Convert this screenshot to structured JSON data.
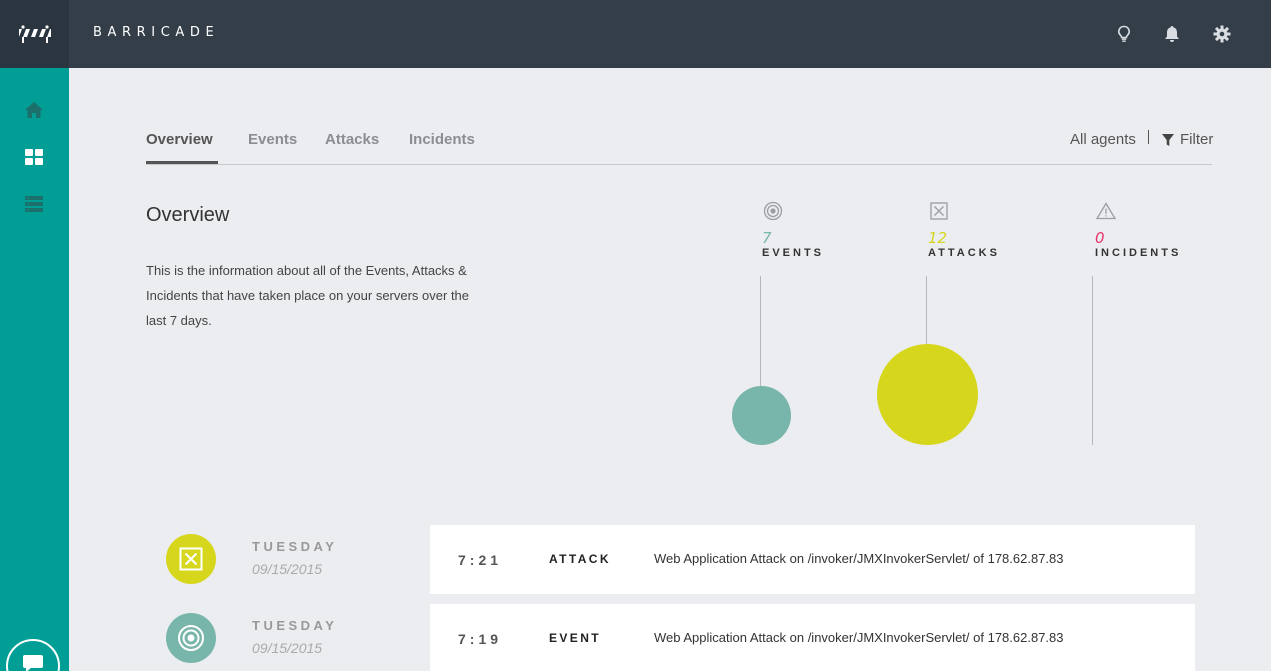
{
  "app": {
    "brand": "BARRICADE"
  },
  "sidebar": {
    "items": [
      {
        "name": "home",
        "icon": "home-icon"
      },
      {
        "name": "dashboard",
        "icon": "grid-icon"
      },
      {
        "name": "servers",
        "icon": "server-icon"
      }
    ]
  },
  "topbar": {
    "icons": [
      "lightbulb-icon",
      "bell-icon",
      "gear-icon"
    ]
  },
  "tabs": [
    {
      "label": "Overview",
      "active": true
    },
    {
      "label": "Events",
      "active": false
    },
    {
      "label": "Attacks",
      "active": false
    },
    {
      "label": "Incidents",
      "active": false
    }
  ],
  "toolbar": {
    "agents_label": "All agents",
    "filter_label": "Filter"
  },
  "overview": {
    "title": "Overview",
    "description": "This is the information about all of the Events, Attacks & Incidents that have taken place on your servers over the last 7 days."
  },
  "stats": [
    {
      "count": "7",
      "label": "EVENTS",
      "icon": "target-icon",
      "color": "#78b5aa"
    },
    {
      "count": "12",
      "label": "ATTACKS",
      "icon": "x-box-icon",
      "color": "#d6d61c"
    },
    {
      "count": "0",
      "label": "INCIDENTS",
      "icon": "warning-icon",
      "color": "#e8336b"
    }
  ],
  "timeline": [
    {
      "day": "TUESDAY",
      "date": "09/15/2015",
      "time": "7:21",
      "type": "ATTACK",
      "message": "Web Application Attack on /invoker/JMXInvokerServlet/ of 178.62.87.83",
      "icon": "x-box-icon",
      "color": "#d6d61c"
    },
    {
      "day": "TUESDAY",
      "date": "09/15/2015",
      "time": "7:19",
      "type": "EVENT",
      "message": "Web Application Attack on /invoker/JMXInvokerServlet/ of 178.62.87.83",
      "icon": "target-icon",
      "color": "#78b5aa"
    }
  ],
  "colors": {
    "sidebar": "#009e94",
    "topbar": "#333e48",
    "event": "#78b5aa",
    "attack": "#d6d61c",
    "incident": "#e8336b"
  }
}
